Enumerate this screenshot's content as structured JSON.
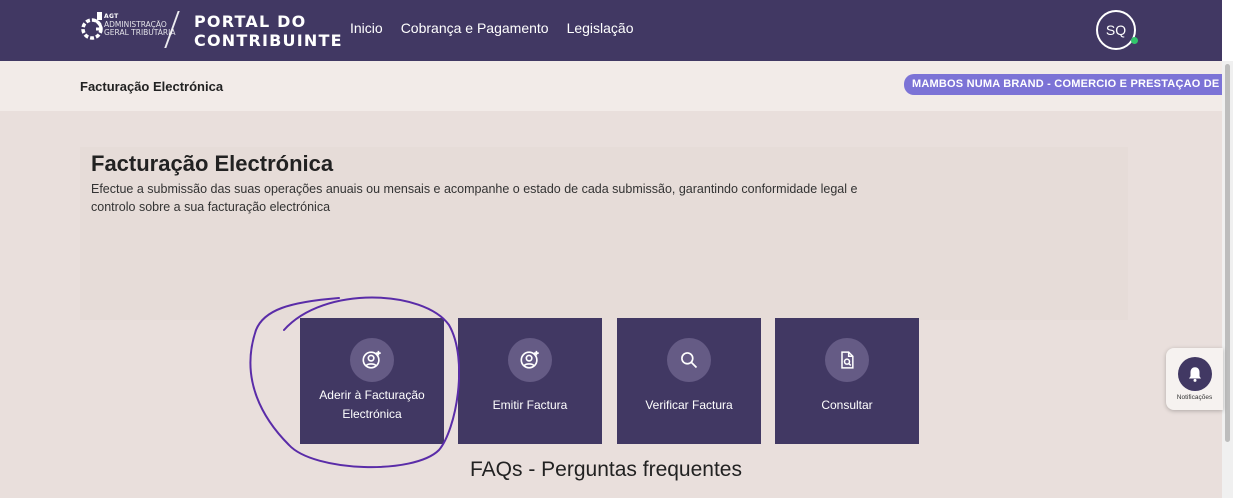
{
  "header": {
    "logo": {
      "abbr": "AGT",
      "name": "Administração Geral Tributária",
      "portal": "PORTAL DO CONTRIBUINTE"
    },
    "nav": [
      {
        "label": "Inicio"
      },
      {
        "label": "Cobrança e Pagamento"
      },
      {
        "label": "Legislação"
      }
    ],
    "user_initials": "SQ"
  },
  "subheader": {
    "title": "Facturação Electrónica",
    "company": "MAMBOS NUMA BRAND - COMERCIO E PRESTAÇAO DE SERVIÇOS"
  },
  "hero": {
    "title": "Facturação Electrónica",
    "description": "Efectue a submissão das suas operações anuais ou mensais e acompanhe o estado de cada submissão, garantindo conformidade legal e controlo sobre a sua facturação electrónica"
  },
  "tiles": [
    {
      "label": "Aderir à Facturação Electrónica",
      "icon": "user-add-icon"
    },
    {
      "label": "Emitir Factura",
      "icon": "user-add-icon"
    },
    {
      "label": "Verificar Factura",
      "icon": "search-icon"
    },
    {
      "label": "Consultar",
      "icon": "document-search-icon"
    }
  ],
  "faq": {
    "title": "FAQs - Perguntas frequentes"
  },
  "notifications": {
    "label": "Notificações",
    "icon": "bell-icon"
  },
  "colors": {
    "primary": "#413863",
    "accent": "#7c73d6",
    "highlight": "#5a2ca8"
  }
}
